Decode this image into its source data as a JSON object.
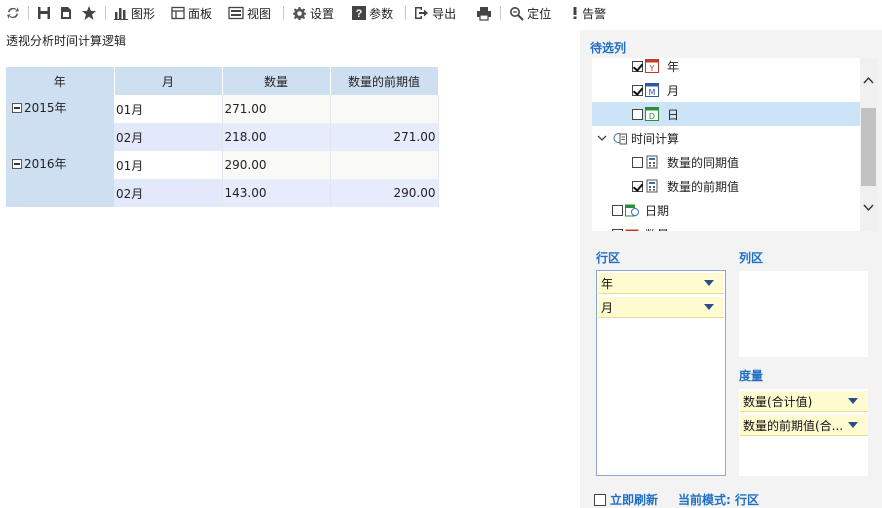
{
  "toolbar": {
    "items": [
      {
        "icon": "refresh-icon",
        "label": ""
      },
      {
        "icon": "save-icon",
        "label": ""
      },
      {
        "icon": "save-as-icon",
        "label": ""
      },
      {
        "icon": "star-icon",
        "label": ""
      },
      {
        "icon": "chart-icon",
        "label": "图形"
      },
      {
        "icon": "panel-icon",
        "label": "面板"
      },
      {
        "icon": "view-icon",
        "label": "视图"
      },
      {
        "icon": "gear-icon",
        "label": "设置"
      },
      {
        "icon": "parameter-icon",
        "label": "参数"
      },
      {
        "icon": "export-icon",
        "label": "导出"
      },
      {
        "icon": "print-icon",
        "label": ""
      },
      {
        "icon": "locate-icon",
        "label": "定位"
      },
      {
        "icon": "alert-icon",
        "label": "告警"
      }
    ]
  },
  "page": {
    "title": "透视分析时间计算逻辑"
  },
  "pivot": {
    "headers": [
      "年",
      "月",
      "数量",
      "数量的前期值"
    ],
    "groups": [
      {
        "year": "2015年",
        "rows": [
          {
            "month": "01月",
            "qty": "271.00",
            "prev": ""
          },
          {
            "month": "02月",
            "qty": "218.00",
            "prev": "271.00"
          }
        ]
      },
      {
        "year": "2016年",
        "rows": [
          {
            "month": "01月",
            "qty": "290.00",
            "prev": ""
          },
          {
            "month": "02月",
            "qty": "143.00",
            "prev": "290.00"
          }
        ]
      }
    ]
  },
  "panel": {
    "candidates_title": "待选列",
    "tree": {
      "year": {
        "label": "年",
        "checked": true,
        "icon_letter": "Y"
      },
      "month": {
        "label": "月",
        "checked": true,
        "icon_letter": "M"
      },
      "day": {
        "label": "日",
        "checked": false,
        "icon_letter": "D"
      },
      "time_calc": {
        "label": "时间计算"
      },
      "same_period": {
        "label": "数量的同期值",
        "checked": false
      },
      "prev_period": {
        "label": "数量的前期值",
        "checked": true
      },
      "date": {
        "label": "日期",
        "checked": false
      },
      "partial": {
        "label": "数量"
      }
    },
    "rows_title": "行区",
    "columns_title": "列区",
    "measures_title": "度量",
    "row_fields": [
      "年",
      "月"
    ],
    "measure_fields": [
      "数量(合计值)",
      "数量的前期值(合..."
    ],
    "refresh_label": "立即刷新",
    "mode_label": "当前模式: 行区"
  },
  "colors": {
    "accent": "#1f6fc5",
    "header_bg": "#cfdff2",
    "chip_bg": "#fffbd0",
    "selected_bg": "#cde4f7"
  }
}
